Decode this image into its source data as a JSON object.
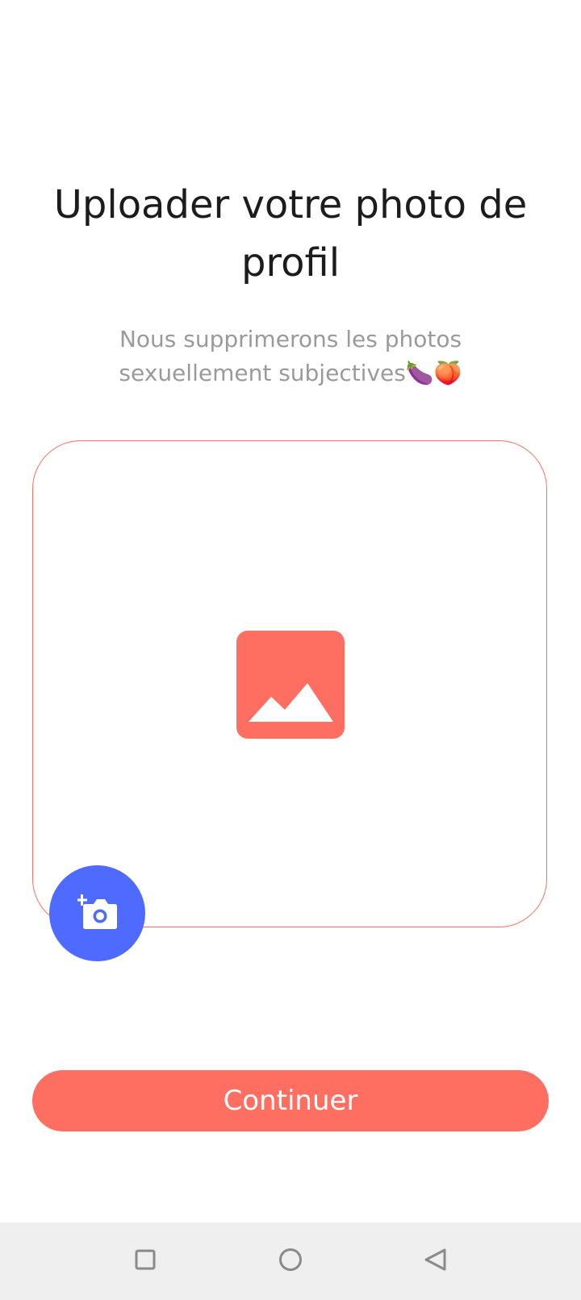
{
  "onboarding": {
    "title": "Uploader votre photo de profil",
    "subtitle": "Nous supprimerons les photos sexuellement subjectives🍆🍑"
  },
  "upload": {
    "placeholder_icon": "image-placeholder-icon",
    "camera_button_icon": "add-photo-camera-icon"
  },
  "actions": {
    "continue_label": "Continuer"
  },
  "system_nav": {
    "recent_icon": "square-icon",
    "home_icon": "circle-icon",
    "back_icon": "triangle-back-icon"
  },
  "colors": {
    "accent": "#ff6f61",
    "camera_button": "#4f6bff",
    "title": "#1c1c1c",
    "subtitle": "#9a9a9a",
    "nav_bg": "#efefef"
  }
}
